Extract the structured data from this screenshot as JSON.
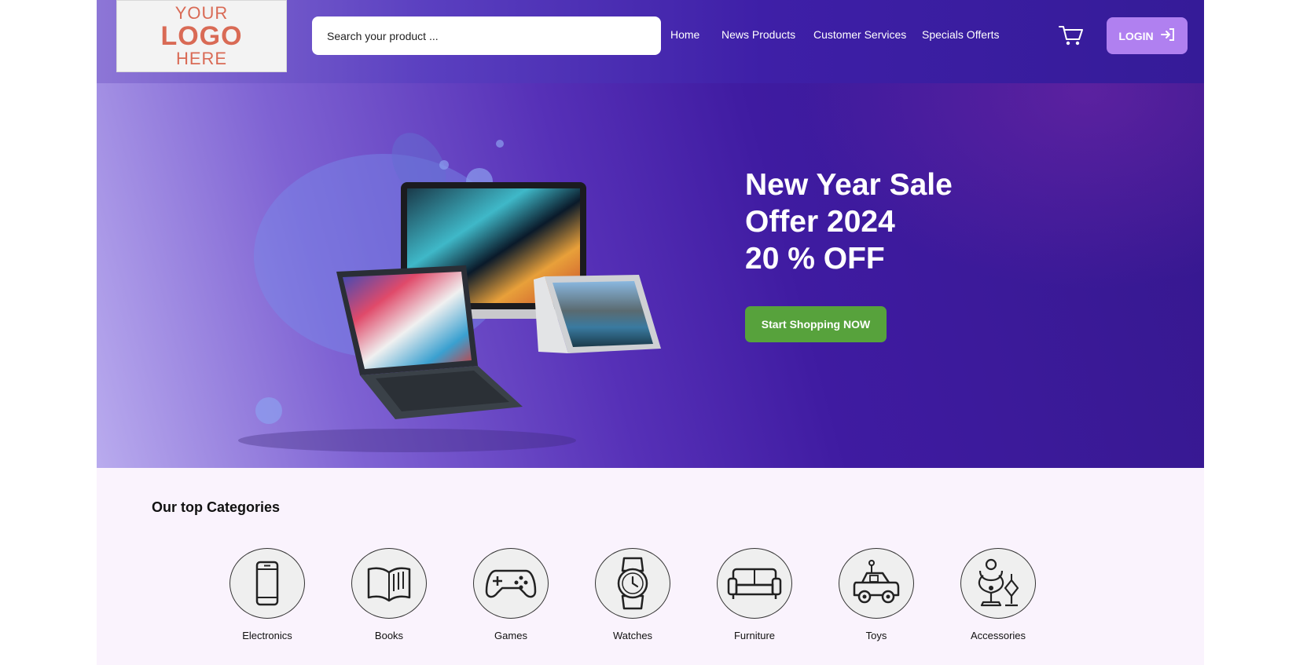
{
  "logo": {
    "line1": "YOUR",
    "line2": "LOGO",
    "line3": "HERE"
  },
  "search": {
    "placeholder": "Search your product ..."
  },
  "nav": {
    "items": [
      {
        "label": "Home"
      },
      {
        "label": "News Products"
      },
      {
        "label": "Customer Services"
      },
      {
        "label": "Specials Offerts"
      }
    ],
    "cart_icon": "cart-icon",
    "login_label": "LOGIN",
    "login_icon": "login-arrow-icon"
  },
  "hero": {
    "title_lines": [
      "New Year Sale",
      "Offer 2024",
      "20 % OFF"
    ],
    "cta_label": "Start Shopping NOW",
    "image": "laptops-image"
  },
  "categories": {
    "title": "Our top Categories",
    "items": [
      {
        "label": "Electronics",
        "icon": "smartphone-icon"
      },
      {
        "label": "Books",
        "icon": "book-icon"
      },
      {
        "label": "Games",
        "icon": "gamepad-icon"
      },
      {
        "label": "Watches",
        "icon": "watch-icon"
      },
      {
        "label": "Furniture",
        "icon": "sofa-icon"
      },
      {
        "label": "Toys",
        "icon": "toy-car-icon"
      },
      {
        "label": "Accessories",
        "icon": "jewelry-icon"
      }
    ]
  },
  "colors": {
    "header_dark": "#351b98",
    "login_button": "#b080f0",
    "cta_button": "#57a23c",
    "categories_bg": "#faf3fd",
    "logo_text": "#d96a55"
  }
}
